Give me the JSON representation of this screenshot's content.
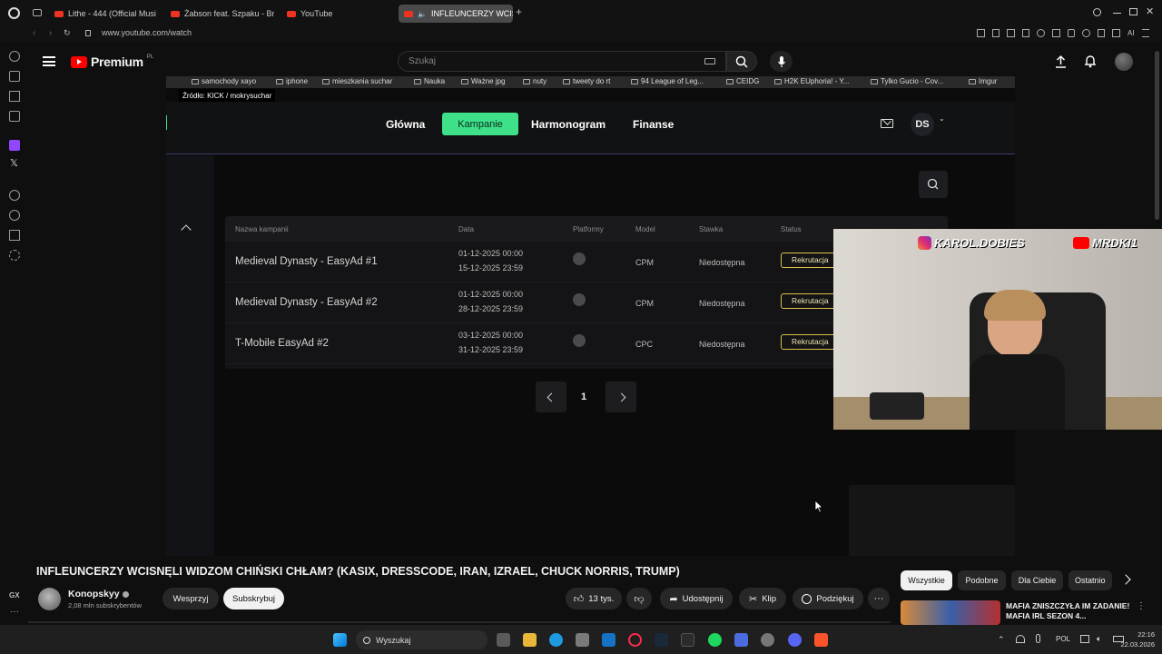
{
  "browser": {
    "tabs": [
      {
        "label": "Lithe - 444 (Official Musi",
        "active": false
      },
      {
        "label": "Żabson feat. Szpaku - Bra",
        "active": false
      },
      {
        "label": "YouTube",
        "active": false
      },
      {
        "label": "INFLEUNCERZY WCISI",
        "active": true
      }
    ],
    "url": "www.youtube.com/watch"
  },
  "youtube": {
    "logo_text": "Premium",
    "logo_region": "PL",
    "search_placeholder": "Szukaj"
  },
  "video": {
    "bookmarks": [
      "samochody xayo",
      "iphone",
      "mieszkania suchar",
      "Nauka",
      "Ważne jpg",
      "nuty",
      "tweety do rt",
      "94 League of Leg...",
      "CEIDG",
      "H2K EUphoria! - Y...",
      "Tylko Gucio - Cov...",
      "Imgur"
    ],
    "source": "Źródło: KICK / mokrysuchar",
    "site": {
      "nav": {
        "home": "Główna",
        "campaigns": "Kampanie",
        "schedule": "Harmonogram",
        "finance": "Finanse"
      },
      "user_initials": "DS",
      "table": {
        "headers": [
          "Nazwa kampanii",
          "Data",
          "Platformy",
          "Model",
          "Stawka",
          "Status"
        ],
        "rows": [
          {
            "name": "Medieval Dynasty - EasyAd #1",
            "date_from": "01-12-2025 00:00",
            "date_to": "15-12-2025 23:59",
            "model": "CPM",
            "stake": "Niedostępna",
            "status": "Rekrutacja"
          },
          {
            "name": "Medieval Dynasty - EasyAd #2",
            "date_from": "01-12-2025 00:00",
            "date_to": "28-12-2025 23:59",
            "model": "CPM",
            "stake": "Niedostępna",
            "status": "Rekrutacja"
          },
          {
            "name": "T-Mobile EasyAd #2",
            "date_from": "03-12-2025 00:00",
            "date_to": "31-12-2025 23:59",
            "model": "CPC",
            "stake": "Niedostępna",
            "status": "Rekrutacja"
          }
        ]
      },
      "page": "1"
    },
    "cam": {
      "handle_instagram": "KAROL.DOBIES",
      "handle_youtube": "MRDKI1"
    }
  },
  "watch": {
    "title": "INFLEUNCERZY WCISNĘLI WIDZOM CHIŃSKI CHŁAM? (KASIX, DRESSCODE, IRAN, IZRAEL, CHUCK NORRIS, TRUMP)",
    "channel": "Konopskyy",
    "subscribers": "2,08 mln subskrybentów",
    "support": "Wesprzyj",
    "subscribe": "Subskrybuj",
    "likes": "13 tys.",
    "share": "Udostępnij",
    "clip": "Klip",
    "thanks": "Podziękuj"
  },
  "related": {
    "chips": [
      "Wszystkie",
      "Podobne",
      "Dla Ciebie",
      "Ostatnio"
    ],
    "first_video_title": "MAFIA ZNISZCZYŁA IM ZADANIE! MAFIA IRL SEZON 4..."
  },
  "taskbar": {
    "search": "Wyszukaj",
    "lang": "POL",
    "time": "22:16",
    "date": "22.03.2026"
  },
  "colors": {
    "accent_green": "#3ee08a",
    "youtube_red": "#ff0000",
    "status_border": "#d8c04a"
  }
}
